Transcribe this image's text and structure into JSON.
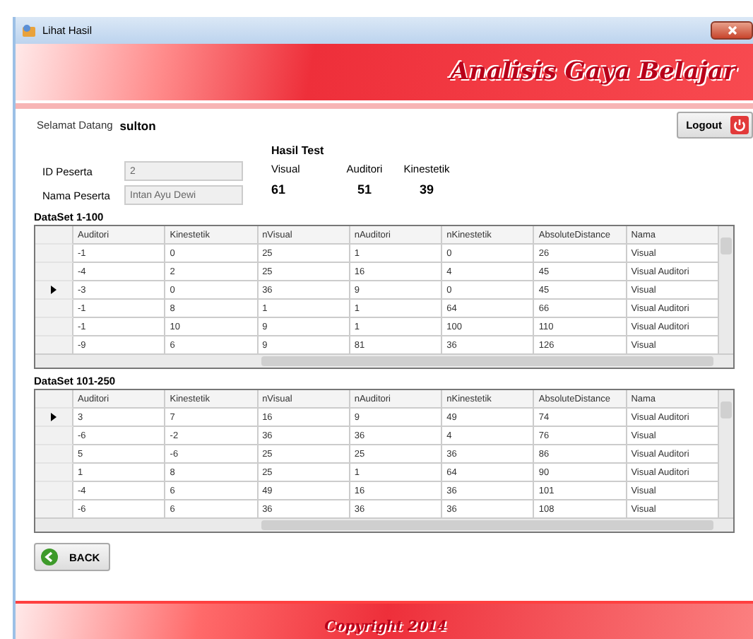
{
  "window": {
    "title": "Lihat Hasil"
  },
  "banner": {
    "title": "Analisis Gaya Belajar"
  },
  "welcome": {
    "label": "Selamat Datang",
    "user": "sulton"
  },
  "logout": {
    "label": "Logout"
  },
  "fields": [
    {
      "label": "ID Peserta",
      "value": "2"
    },
    {
      "label": "Nama Peserta",
      "value": "Intan Ayu Dewi"
    }
  ],
  "hasil": {
    "title": "Hasil Test",
    "scores": [
      {
        "label": "Visual",
        "value": "61"
      },
      {
        "label": "Auditori",
        "value": "51"
      },
      {
        "label": "Kinestetik",
        "value": "39"
      }
    ]
  },
  "grids": [
    {
      "title": "DataSet 1-100",
      "columns": [
        "Auditori",
        "Kinestetik",
        "nVisual",
        "nAuditori",
        "nKinestetik",
        "AbsoluteDistance",
        "Nama"
      ],
      "rows": [
        {
          "selected": false,
          "cells": [
            "-1",
            "0",
            "25",
            "1",
            "0",
            "26",
            "Visual"
          ]
        },
        {
          "selected": false,
          "cells": [
            "-4",
            "2",
            "25",
            "16",
            "4",
            "45",
            "Visual Auditori"
          ]
        },
        {
          "selected": true,
          "cells": [
            "-3",
            "0",
            "36",
            "9",
            "0",
            "45",
            "Visual"
          ]
        },
        {
          "selected": false,
          "cells": [
            "-1",
            "8",
            "1",
            "1",
            "64",
            "66",
            "Visual Auditori"
          ]
        },
        {
          "selected": false,
          "cells": [
            "-1",
            "10",
            "9",
            "1",
            "100",
            "110",
            "Visual Auditori"
          ]
        },
        {
          "selected": false,
          "cells": [
            "-9",
            "6",
            "9",
            "81",
            "36",
            "126",
            "Visual"
          ]
        }
      ]
    },
    {
      "title": "DataSet 101-250",
      "columns": [
        "Auditori",
        "Kinestetik",
        "nVisual",
        "nAuditori",
        "nKinestetik",
        "AbsoluteDistance",
        "Nama"
      ],
      "rows": [
        {
          "selected": true,
          "cells": [
            "3",
            "7",
            "16",
            "9",
            "49",
            "74",
            "Visual Auditori"
          ]
        },
        {
          "selected": false,
          "cells": [
            "-6",
            "-2",
            "36",
            "36",
            "4",
            "76",
            "Visual"
          ]
        },
        {
          "selected": false,
          "cells": [
            "5",
            "-6",
            "25",
            "25",
            "36",
            "86",
            "Visual Auditori"
          ]
        },
        {
          "selected": false,
          "cells": [
            "1",
            "8",
            "25",
            "1",
            "64",
            "90",
            "Visual Auditori"
          ]
        },
        {
          "selected": false,
          "cells": [
            "-4",
            "6",
            "49",
            "16",
            "36",
            "101",
            "Visual"
          ]
        },
        {
          "selected": false,
          "cells": [
            "-6",
            "6",
            "36",
            "36",
            "36",
            "108",
            "Visual"
          ]
        }
      ]
    }
  ],
  "back": {
    "label": "BACK"
  },
  "footer": {
    "text": "Copyright 2014"
  }
}
